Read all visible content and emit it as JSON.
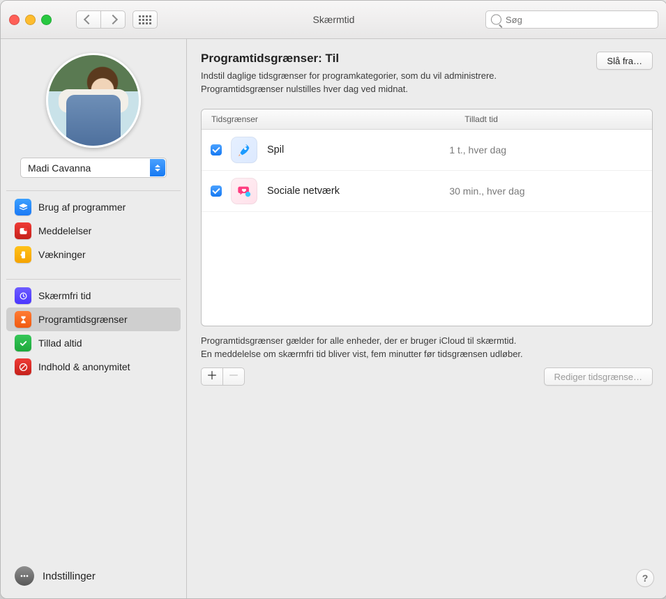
{
  "window_title": "Skærmtid",
  "search": {
    "placeholder": "Søg"
  },
  "user": {
    "name": "Madi Cavanna"
  },
  "sidebar": {
    "section1": [
      {
        "label": "Brug af programmer"
      },
      {
        "label": "Meddelelser"
      },
      {
        "label": "Vækninger"
      }
    ],
    "section2": [
      {
        "label": "Skærmfri tid"
      },
      {
        "label": "Programtidsgrænser"
      },
      {
        "label": "Tillad altid"
      },
      {
        "label": "Indhold & anonymitet"
      }
    ],
    "options_label": "Indstillinger"
  },
  "header": {
    "title": "Programtidsgrænser: Til",
    "description": "Indstil daglige tidsgrænser for programkategorier, som du vil administrere. Programtidsgrænser nulstilles hver dag ved midnat.",
    "turn_off_label": "Slå fra…"
  },
  "table": {
    "columns": {
      "limits": "Tidsgrænser",
      "allowed": "Tilladt tid"
    },
    "rows": [
      {
        "checked": true,
        "icon": "rocket-icon",
        "label": "Spil",
        "time": "1 t., hver dag"
      },
      {
        "checked": true,
        "icon": "heart-bubble-icon",
        "label": "Sociale netværk",
        "time": "30 min., hver dag"
      }
    ]
  },
  "footer": {
    "text": "Programtidsgrænser gælder for alle enheder, der er bruger iCloud til skærmtid.\nEn meddelelse om skærmfri tid bliver vist, fem minutter før tidsgrænsen udløber.",
    "edit_label": "Rediger tidsgrænse…"
  },
  "help_label": "?"
}
